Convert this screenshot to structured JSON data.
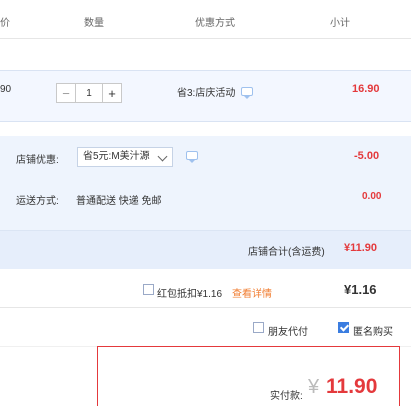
{
  "header": {
    "col_price_fragment": "价",
    "col_quantity": "数量",
    "col_promo": "优惠方式",
    "col_subtotal": "小计"
  },
  "item": {
    "price_fragment": "90",
    "quantity": "1",
    "minus": "−",
    "plus": "+",
    "promo": "省3:店庆活动",
    "subtotal": "16.90"
  },
  "shop": {
    "discount_label": "店铺优惠:",
    "discount_select": "省5元:M美汁源",
    "discount_amount": "-5.00",
    "shipping_label": "运送方式:",
    "shipping_method": "普通配送 快递 免邮",
    "shipping_amount": "0.00",
    "total_label": "店铺合计(含运费)",
    "total_amount": "¥11.90"
  },
  "redpacket": {
    "label": "红包抵扣¥1.16",
    "details_link": "查看详情",
    "amount": "¥1.16"
  },
  "options": {
    "friend_pay": "朋友代付",
    "anonymous": "匿名购买"
  },
  "payment": {
    "label": "实付款:",
    "currency": "¥",
    "amount": "11.90"
  },
  "colors": {
    "accent_red": "#e4393c",
    "link_orange": "#f07b2e",
    "panel_blue": "#eef4fd",
    "checkbox_blue": "#3b7de0"
  }
}
